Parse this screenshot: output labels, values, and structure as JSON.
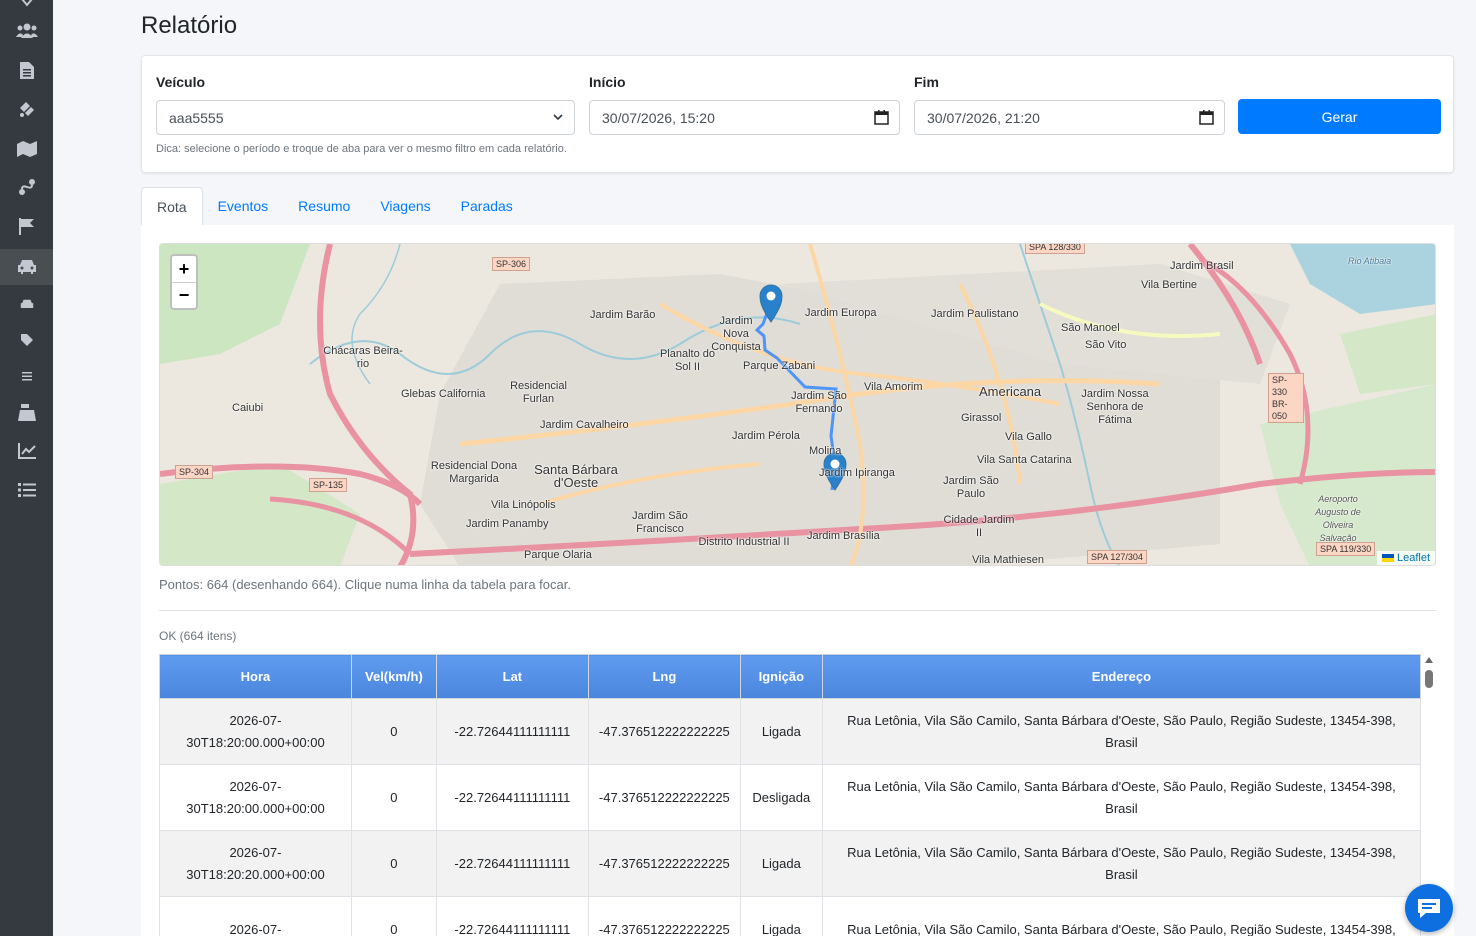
{
  "page": {
    "title": "Relatório"
  },
  "sidebar": {
    "items": [
      {
        "icon": "users-icon"
      },
      {
        "icon": "file-icon"
      },
      {
        "icon": "satellite-icon"
      },
      {
        "icon": "map-icon"
      },
      {
        "icon": "route-icon"
      },
      {
        "icon": "flag-icon"
      },
      {
        "icon": "car-icon",
        "active": true
      },
      {
        "icon": "car-small-icon"
      },
      {
        "icon": "tag-icon"
      },
      {
        "icon": "list-small-icon"
      },
      {
        "icon": "cash-register-icon"
      },
      {
        "icon": "chart-line-icon"
      },
      {
        "icon": "list-icon"
      }
    ]
  },
  "filter": {
    "vehicle_label": "Veículo",
    "vehicle_value": "aaa5555",
    "start_label": "Início",
    "start_value": "30/07/2026, 15:20",
    "end_label": "Fim",
    "end_value": "30/07/2026, 21:20",
    "generate_label": "Gerar",
    "hint": "Dica: selecione o período e troque de aba para ver o mesmo filtro em cada relatório."
  },
  "tabs": [
    {
      "label": "Rota",
      "active": true
    },
    {
      "label": "Eventos"
    },
    {
      "label": "Resumo"
    },
    {
      "label": "Viagens"
    },
    {
      "label": "Paradas"
    }
  ],
  "map": {
    "zoom_in": "+",
    "zoom_out": "−",
    "attribution": "Leaflet",
    "labels": [
      "Jardim Barão",
      "Jardim Nova Conquista",
      "Jardim Europa",
      "Jardim Paulistano",
      "Jardim Brasil",
      "Vila Bertine",
      "São Manoel",
      "São Vito",
      "Chácaras Beira-rio",
      "Planalto do Sol II",
      "Parque Zabani",
      "Glebas California",
      "Residencial Furlan",
      "Vila Amorim",
      "Americana",
      "Jardim Nossa Senhora de Fátima",
      "Caiubi",
      "Jardim São Fernando",
      "Girassol",
      "Jardim Cavalheiro",
      "Jardim Pérola",
      "Vila Gallo",
      "Molina",
      "Jardim Ipiranga",
      "Vila Santa Catarina",
      "Residencial Dona Margarida",
      "Santa Bárbara d'Oeste",
      "Jardim São Paulo",
      "Vila Linópolis",
      "Jardim São Francisco",
      "Cidade Jardim II",
      "Jardim Panamby",
      "Distrito Industrial II",
      "Jardim Brasília",
      "Parque Olaria",
      "Vila Mathiesen",
      "Aeroporto Augusto de Oliveira Salvação",
      "Rio Atibaia"
    ],
    "shields": [
      "SP-306",
      "SP-304",
      "SP-135",
      "SP-330 BR-050",
      "SPA 127/304",
      "SPA 119/330",
      "SPA 128/330"
    ]
  },
  "points_text": "Pontos: 664 (desenhando 664). Clique numa linha da tabela para focar.",
  "status_text": "OK (664 itens)",
  "table": {
    "headers": [
      "Hora",
      "Vel(km/h)",
      "Lat",
      "Lng",
      "Ignição",
      "Endereço"
    ],
    "rows": [
      {
        "hora_1": "2026-07-",
        "hora_2": "30T18:20:00.000+00:00",
        "vel": "0",
        "lat": "-22.72644111111111",
        "lng": "-47.376512222222225",
        "ign": "Ligada",
        "end_1": "Rua Letônia, Vila São Camilo, Santa Bárbara d'Oeste, São Paulo, Região Sudeste, 13454-398,",
        "end_2": "Brasil"
      },
      {
        "hora_1": "2026-07-",
        "hora_2": "30T18:20:00.000+00:00",
        "vel": "0",
        "lat": "-22.72644111111111",
        "lng": "-47.376512222222225",
        "ign": "Desligada",
        "end_1": "Rua Letônia, Vila São Camilo, Santa Bárbara d'Oeste, São Paulo, Região Sudeste, 13454-398,",
        "end_2": "Brasil"
      },
      {
        "hora_1": "2026-07-",
        "hora_2": "30T18:20:20.000+00:00",
        "vel": "0",
        "lat": "-22.72644111111111",
        "lng": "-47.376512222222225",
        "ign": "Ligada",
        "end_1": "Rua Letônia, Vila São Camilo, Santa Bárbara d'Oeste, São Paulo, Região Sudeste, 13454-398,",
        "end_2": "Brasil"
      },
      {
        "hora_1": "2026-07-",
        "hora_2": "",
        "vel": "0",
        "lat": "-22.72644111111111",
        "lng": "-47.376512222222225",
        "ign": "Ligada",
        "end_1": "Rua Letônia, Vila São Camilo, Santa Bárbara d'Oeste, São Paulo, Região Sudeste, 13454-398,",
        "end_2": ""
      }
    ]
  },
  "colors": {
    "primary": "#007bff",
    "sidebar": "#343a40",
    "table_header": "#5b94e6",
    "route": "#3388ff"
  }
}
